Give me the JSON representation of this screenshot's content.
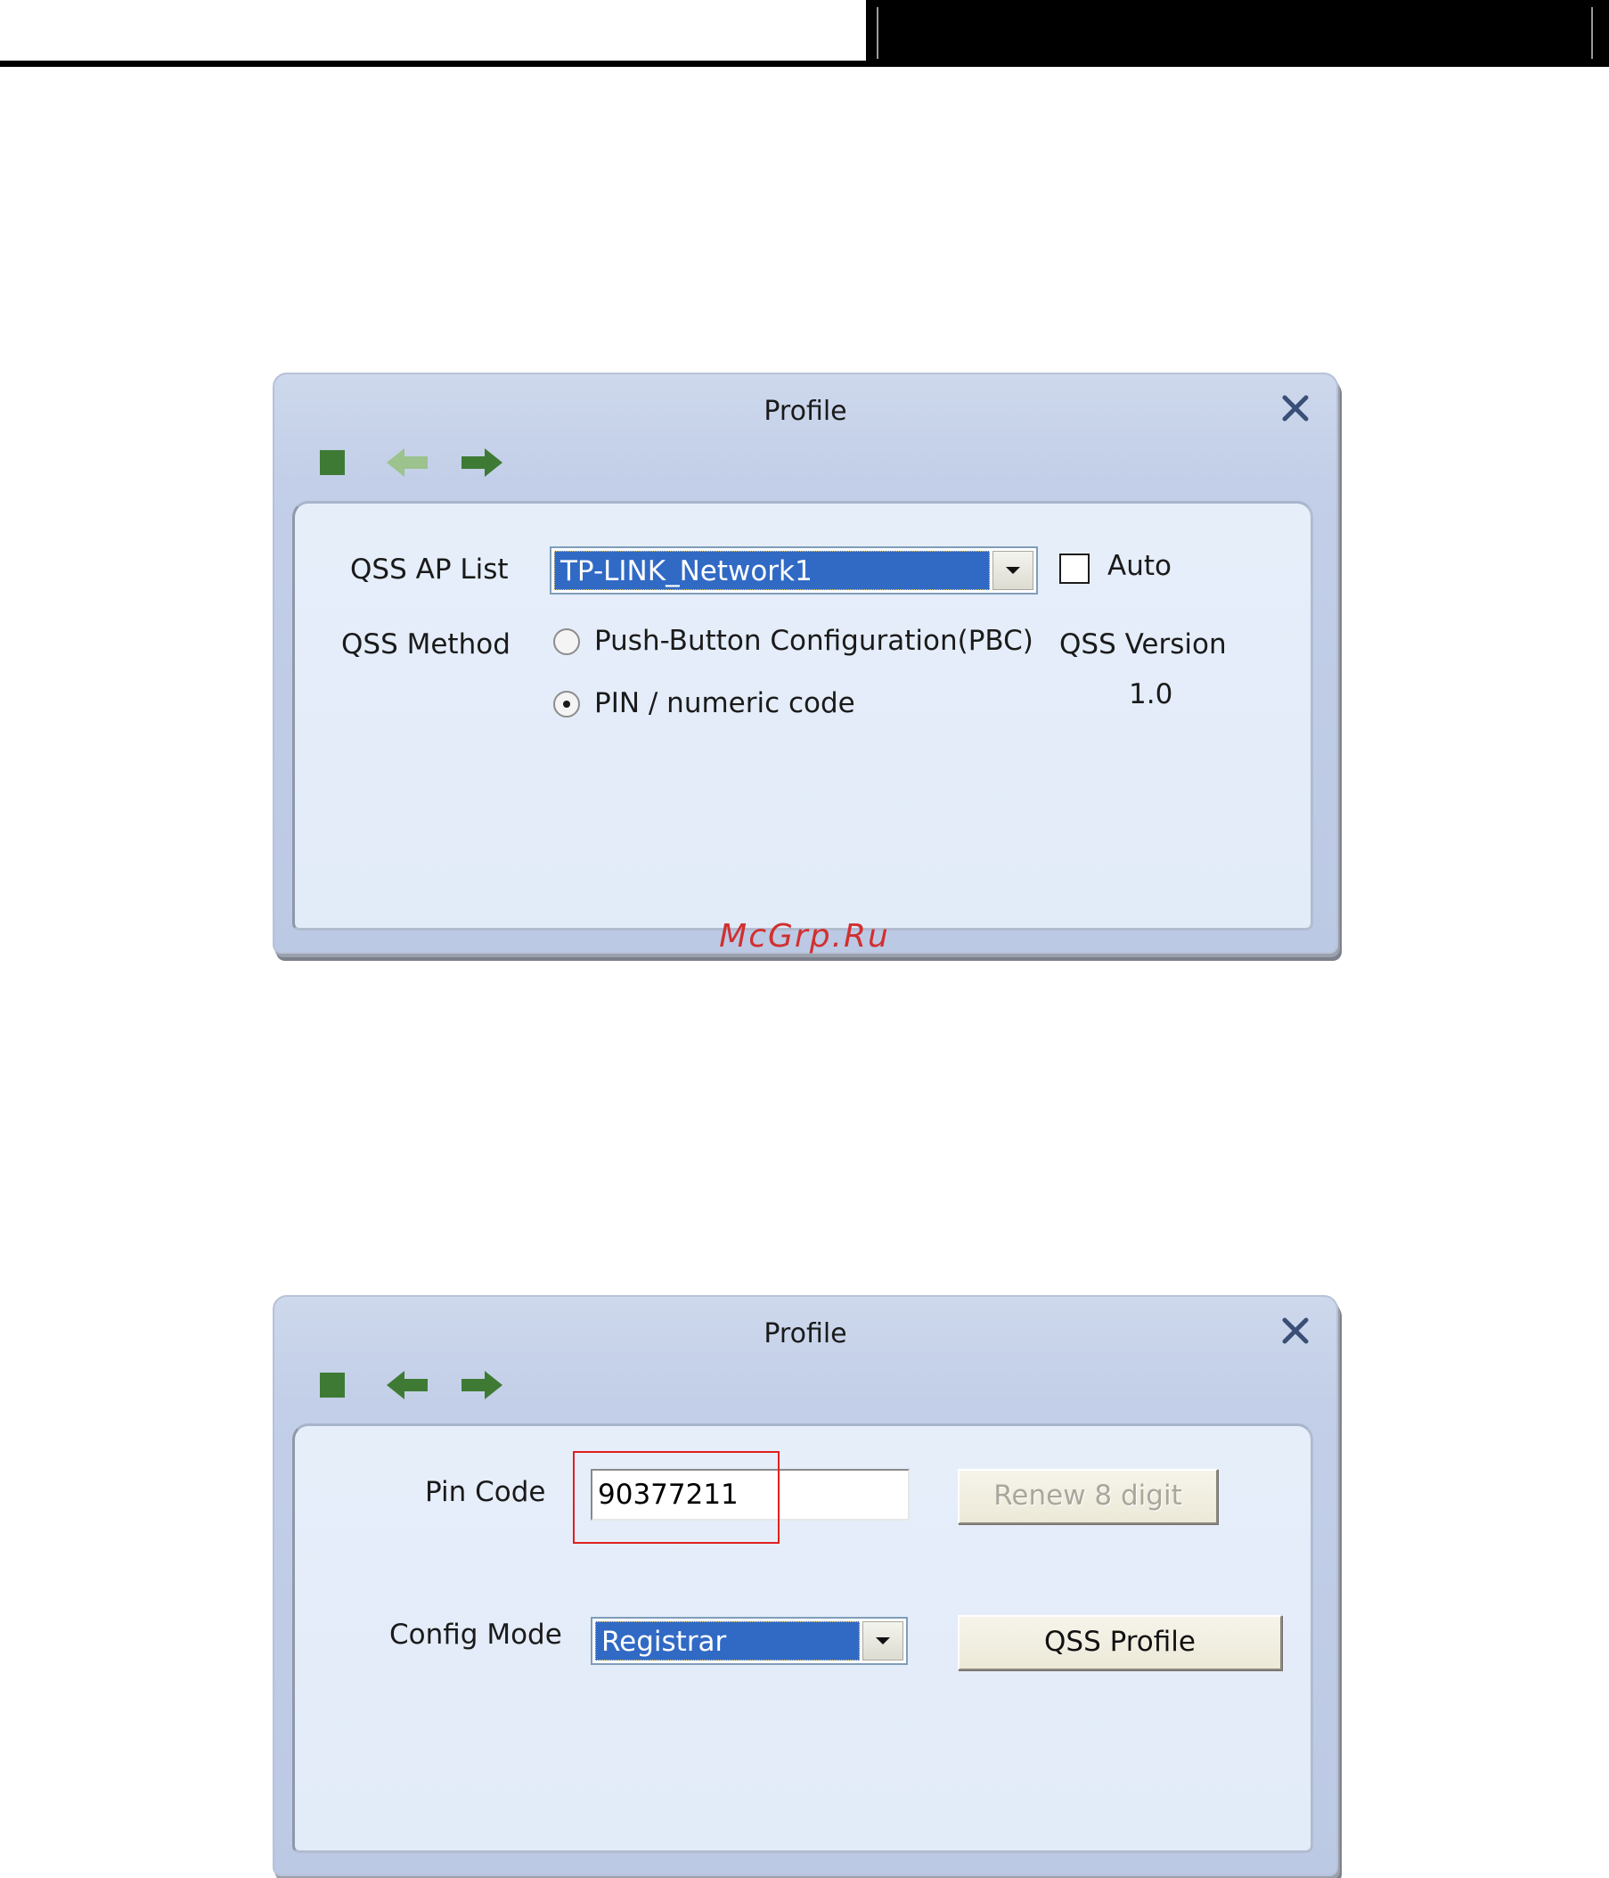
{
  "watermark": "McGrp.Ru",
  "colors": {
    "accent": "#316ac5",
    "highlight": "#e02020",
    "toolbar_icon": "#3f7a35"
  },
  "dialog1": {
    "title": "Profile",
    "toolbar": [
      "stop-square-icon",
      "back-arrow-icon",
      "forward-arrow-icon"
    ],
    "ap_list_label": "QSS AP List",
    "ap_list_value": "TP-LINK_Network1",
    "auto_label": "Auto",
    "auto_checked": false,
    "method_label": "QSS Method",
    "method_pbc_label": "Push-Button Configuration(PBC)",
    "method_pin_label": "PIN / numeric code",
    "selected_method": "PIN / numeric code",
    "version_label": "QSS Version",
    "version_value": "1.0"
  },
  "dialog2": {
    "title": "Profile",
    "toolbar": [
      "stop-square-icon",
      "back-arrow-icon",
      "forward-arrow-icon"
    ],
    "pin_label": "Pin Code",
    "pin_value": "90377211",
    "renew_label": "Renew 8 digit",
    "config_label": "Config Mode",
    "config_value": "Registrar",
    "qss_profile_label": "QSS Profile"
  }
}
